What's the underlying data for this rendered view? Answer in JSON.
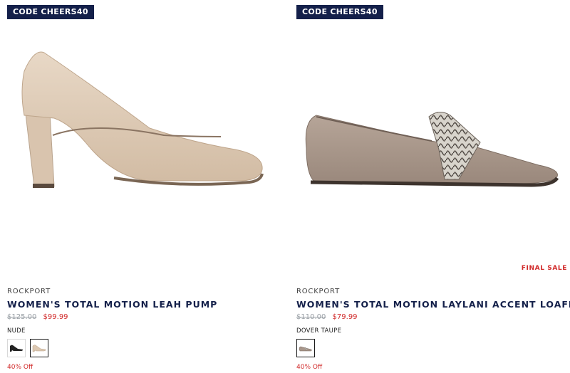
{
  "products": [
    {
      "promo": "CODE CHEERS40",
      "brand": "ROCKPORT",
      "title": "WOMEN'S TOTAL MOTION LEAH PUMP",
      "old_price": "$125.00",
      "sale_price": "$99.99",
      "color": "NUDE",
      "swatch_icons": [
        "black-pump-thumbnail-icon",
        "nude-pump-thumbnail-icon"
      ],
      "discount": "40% Off"
    },
    {
      "promo": "CODE CHEERS40",
      "final_sale": "FINAL SALE",
      "brand": "ROCKPORT",
      "title": "WOMEN'S TOTAL MOTION LAYLANI ACCENT LOAFER",
      "old_price": "$110.00",
      "sale_price": "$79.99",
      "color": "DOVER TAUPE",
      "swatch_icons": [
        "taupe-loafer-thumbnail-icon"
      ],
      "discount": "40% Off"
    }
  ],
  "colors": {
    "promo_bg": "#14204a",
    "title": "#14204a",
    "sale": "#d12a2a",
    "old_price": "#9aa0a6",
    "nude": "#dcc8b2",
    "taupe": "#a8968a"
  }
}
